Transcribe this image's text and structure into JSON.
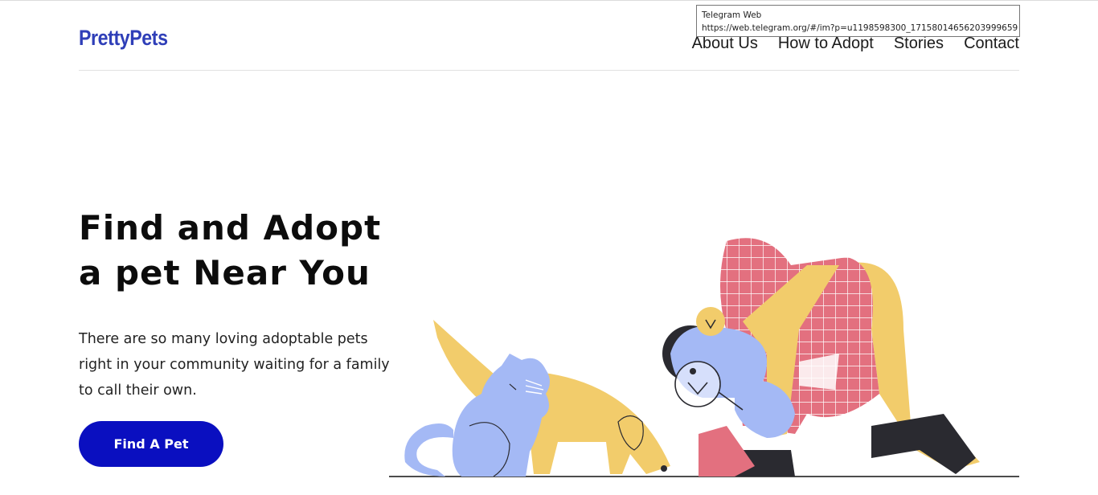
{
  "header": {
    "logo": "PrettyPets",
    "nav": [
      {
        "label": "About Us"
      },
      {
        "label": "How to Adopt"
      },
      {
        "label": "Stories"
      },
      {
        "label": "Contact"
      }
    ]
  },
  "tooltip": {
    "title": "Telegram Web",
    "url": "https://web.telegram.org/#/im?p=u1198598300_17158014656203999659"
  },
  "hero": {
    "title_line1": "Find and Adopt",
    "title_line2": "a pet Near You",
    "description": "There are so many loving adoptable pets right in your community waiting for a family to call their own.",
    "cta_label": "Find A Pet"
  },
  "colors": {
    "brand": "#2f3fb8",
    "cta": "#0a0fc0",
    "pink": "#e3707f",
    "yellow": "#f2cc6b",
    "blue": "#a4b9f5",
    "dark": "#2a2a30"
  }
}
